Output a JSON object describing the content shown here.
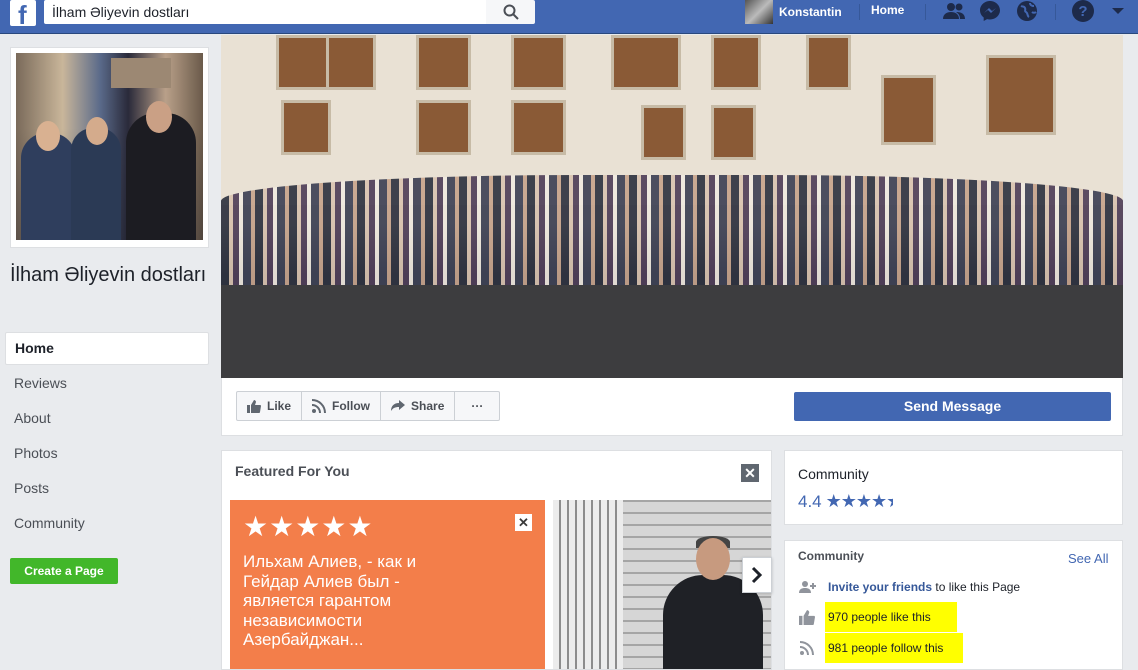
{
  "topbar": {
    "search_value": "İlham Əliyevin dostları",
    "user_name": "Konstantin",
    "home_label": "Home",
    "icons": [
      "search-icon",
      "friends-icon",
      "messenger-icon",
      "globe-icon",
      "help-icon",
      "dropdown-arrow-icon"
    ]
  },
  "page": {
    "title": "İlham Əliyevin dostları"
  },
  "nav": {
    "items": [
      "Home",
      "Reviews",
      "About",
      "Photos",
      "Posts",
      "Community"
    ],
    "create_page": "Create a Page"
  },
  "actions": {
    "like": "Like",
    "follow": "Follow",
    "share": "Share",
    "more": "···",
    "send_message": "Send Message"
  },
  "featured": {
    "title": "Featured For You",
    "stars": "★★★★★",
    "card_text": "Ильхам Алиев, - как и Гейдар Алиев был - является гарантом независимости Азербайджан..."
  },
  "community_rating": {
    "title": "Community",
    "rating": "4.4"
  },
  "community": {
    "title": "Community",
    "see_all": "See All",
    "invite_link": "Invite your friends",
    "invite_rest": "to like this Page",
    "likes": "970 people like this",
    "follows": "981 people follow this"
  },
  "colors": {
    "brand": "#4267b2",
    "green": "#42b72a",
    "orange_card": "#f37e4a",
    "highlight": "#ffff00"
  }
}
